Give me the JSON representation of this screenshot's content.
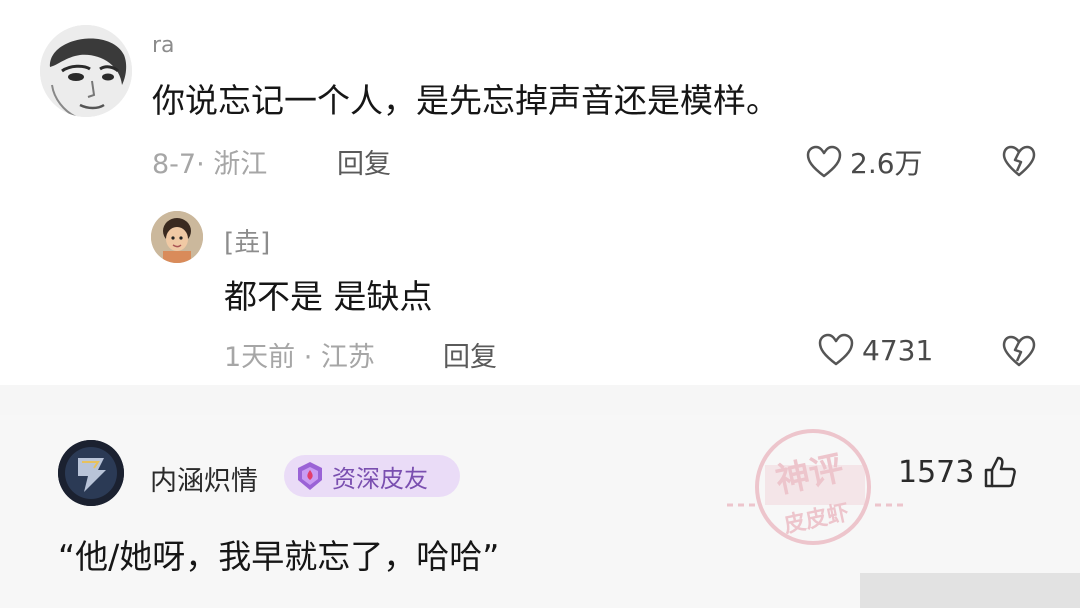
{
  "comment": {
    "username": "ra",
    "text": "你说忘记一个人，是先忘掉声音还是模样。",
    "meta": "8-7· 浙江",
    "reply_label": "回复",
    "likes": "2.6万",
    "icons": [
      "avatar-portrait",
      "heart-outline-icon",
      "broken-heart-icon"
    ]
  },
  "reply": {
    "username": "[垚]",
    "text": "都不是  是缺点",
    "meta": "1天前 · 江苏",
    "reply_label": "回复",
    "likes": "4731",
    "icons": [
      "avatar-child",
      "heart-outline-icon",
      "broken-heart-icon"
    ]
  },
  "card": {
    "username": "内涵炽情",
    "badge": "资深皮友",
    "likes": "1573",
    "text": "“他/她呀，我早就忘了，哈哈”",
    "icons": [
      "avatar-dark",
      "badge-emblem-icon",
      "thumbs-up-icon"
    ]
  },
  "watermark": {
    "line1": "神评",
    "line2": "皮皮虾"
  },
  "colors": {
    "badge_bg": "#eadcf7",
    "badge_text": "#7a4fb0",
    "meta_gray": "#a6a6a6",
    "watermark_red": "#d9536b"
  }
}
